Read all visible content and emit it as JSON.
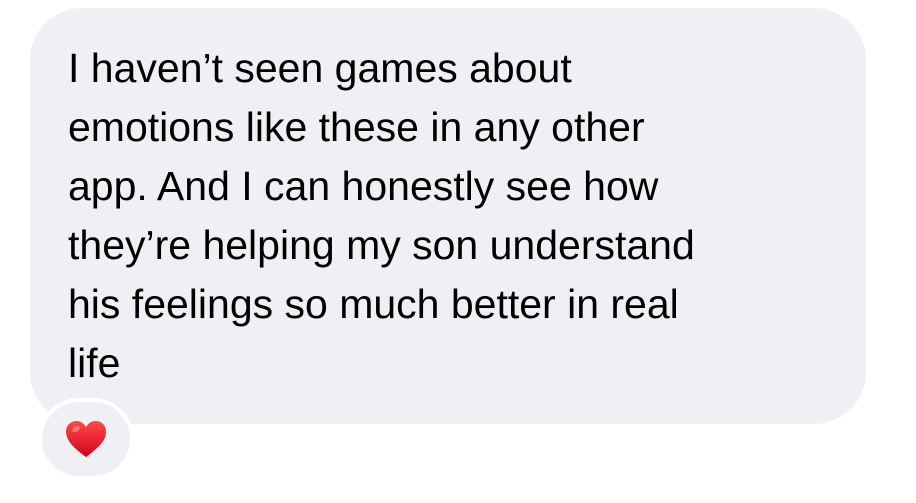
{
  "message": {
    "lines": [
      "I haven’t seen games about",
      "emotions like these in any other",
      "app. And I can honestly see how",
      "they’re helping my son understand",
      "his feelings so much better in real",
      "life"
    ],
    "bubble_color": "#eff0f3",
    "text_color": "#000000"
  },
  "reaction": {
    "icon": "red-heart-icon",
    "color": "#e8112d"
  }
}
